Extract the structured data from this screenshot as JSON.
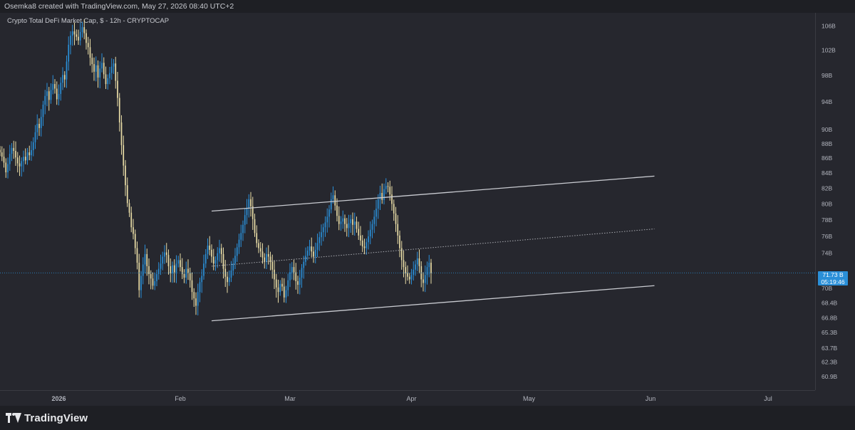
{
  "header": {
    "caption": "Osemka8 created with TradingView.com, May 27, 2026 08:40 UTC+2"
  },
  "footer": {
    "brand": "TradingView",
    "logo_icon": "tradingview-logo-icon"
  },
  "colors": {
    "background": "#26272e",
    "up_candle": "#2a8fd8",
    "down_candle": "#e8dca6",
    "channel_line": "#c9cbd1",
    "price_line": "#2a8fd8"
  },
  "chart_data": {
    "type": "candlestick",
    "title": "Crypto Total DeFi Market Cap, $ - 12h - CRYPTOCAP",
    "timeframe": "12h",
    "y_scale": "log",
    "ylim": [
      60.0,
      107.5
    ],
    "y_ticks": [
      "106B",
      "102B",
      "98B",
      "94B",
      "90B",
      "88B",
      "86B",
      "84B",
      "82B",
      "80B",
      "78B",
      "76B",
      "74B",
      "70B",
      "68.4B",
      "66.8B",
      "65.3B",
      "63.7B",
      "62.3B",
      "60.9B"
    ],
    "y_tick_values": [
      106,
      102,
      98,
      94,
      90,
      88,
      86,
      84,
      82,
      80,
      78,
      76,
      74,
      70,
      68.4,
      66.8,
      65.3,
      63.7,
      62.3,
      60.9
    ],
    "x_ticks": [
      "2026",
      "Feb",
      "Mar",
      "Apr",
      "May",
      "Jun",
      "Jul"
    ],
    "x_tick_dates": [
      "2026-01-01",
      "2026-02-01",
      "2026-03-01",
      "2026-04-01",
      "2026-05-01",
      "2026-06-01",
      "2026-07-01"
    ],
    "xlim": [
      "2025-12-17",
      "2026-07-13"
    ],
    "last_price": "71.73 B",
    "countdown": "05:19:46",
    "last_value": 71.73,
    "close_series_start": "2025-12-17",
    "close_series_interval": "12h",
    "close_series": [
      86.8,
      86.2,
      85.4,
      84.1,
      85.2,
      86.6,
      87.4,
      87.0,
      86.1,
      85.3,
      84.9,
      85.6,
      86.2,
      85.7,
      86.8,
      86.4,
      87.1,
      88.2,
      89.6,
      90.8,
      90.2,
      91.8,
      93.6,
      94.9,
      95.6,
      94.3,
      95.8,
      96.7,
      96.0,
      94.4,
      95.2,
      96.9,
      98.1,
      97.4,
      100.2,
      102.9,
      104.4,
      105.1,
      104.6,
      104.2,
      103.6,
      105.0,
      105.8,
      104.8,
      103.2,
      102.5,
      100.8,
      99.8,
      98.6,
      99.6,
      97.7,
      99.1,
      100.0,
      98.2,
      96.7,
      97.6,
      98.4,
      99.4,
      99.9,
      97.2,
      94.6,
      91.0,
      87.8,
      85.0,
      82.4,
      80.1,
      78.9,
      77.1,
      76.3,
      74.6,
      72.9,
      69.8,
      71.4,
      72.7,
      73.9,
      72.5,
      71.6,
      71.1,
      70.3,
      70.8,
      71.6,
      72.2,
      72.8,
      73.6,
      74.1,
      73.8,
      72.5,
      71.7,
      72.6,
      71.8,
      72.8,
      73.2,
      72.4,
      71.6,
      71.2,
      72.2,
      71.7,
      70.9,
      69.6,
      68.9,
      68.1,
      69.6,
      70.7,
      71.4,
      72.8,
      73.9,
      74.9,
      74.4,
      73.6,
      72.8,
      73.2,
      74.0,
      74.6,
      73.9,
      72.2,
      71.3,
      70.7,
      71.2,
      72.0,
      72.8,
      73.7,
      74.7,
      75.6,
      76.4,
      77.4,
      78.6,
      79.5,
      80.6,
      79.7,
      78.1,
      76.4,
      75.2,
      74.6,
      74.2,
      73.5,
      73.0,
      73.9,
      73.6,
      73.0,
      72.1,
      71.0,
      70.1,
      69.6,
      70.5,
      70.2,
      69.0,
      69.8,
      70.9,
      71.8,
      72.4,
      71.8,
      70.8,
      70.4,
      71.2,
      72.3,
      73.0,
      73.7,
      74.3,
      74.8,
      74.2,
      73.6,
      74.4,
      75.2,
      75.9,
      76.5,
      77.1,
      77.7,
      78.4,
      79.3,
      80.6,
      81.1,
      79.8,
      78.5,
      77.5,
      77.8,
      78.2,
      77.5,
      77.0,
      77.6,
      78.1,
      77.4,
      77.8,
      76.9,
      76.1,
      75.5,
      74.8,
      74.6,
      75.3,
      76.0,
      76.8,
      77.5,
      78.4,
      79.4,
      80.6,
      81.4,
      80.5,
      81.9,
      82.3,
      82.2,
      81.2,
      80.0,
      78.8,
      77.5,
      76.1,
      74.6,
      73.2,
      72.4,
      71.7,
      71.3,
      71.0,
      71.5,
      72.1,
      72.7,
      73.4,
      72.5,
      71.0,
      70.6,
      71.5,
      72.4,
      72.9,
      71.73
    ],
    "channel_upper": {
      "start": [
        "2026-02-09",
        79.1
      ],
      "end": [
        "2026-06-02",
        83.6
      ]
    },
    "channel_lower": {
      "start": [
        "2026-02-09",
        66.5
      ],
      "end": [
        "2026-06-02",
        70.3
      ]
    },
    "channel_mid": {
      "start": [
        "2026-02-09",
        72.5
      ],
      "end": [
        "2026-06-02",
        76.9
      ]
    },
    "grid": false
  }
}
